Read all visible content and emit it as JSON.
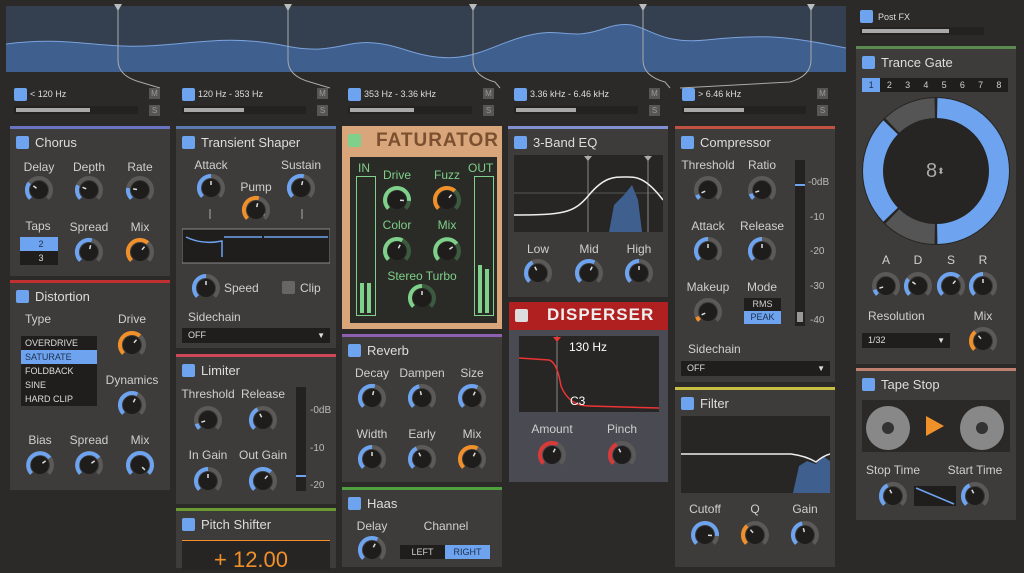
{
  "colors": {
    "accent": "#6ea4ef",
    "orange": "#f0902a",
    "green": "#7fd08a",
    "red": "#d83a3a",
    "track": "#5b5a58"
  },
  "bands": [
    {
      "label": "< 120 Hz",
      "level": 0.62
    },
    {
      "label": "120 Hz - 353 Hz",
      "level": 0.5
    },
    {
      "label": "353 Hz - 3.36 kHz",
      "level": 0.53
    },
    {
      "label": "3.36 kHz - 6.46 kHz",
      "level": 0.5
    },
    {
      "label": "> 6.46 kHz",
      "level": 0.5
    }
  ],
  "band_buttons": {
    "mute": "M",
    "solo": "S"
  },
  "post_fx": {
    "label": "Post FX",
    "level": 0.7
  },
  "chorus": {
    "title": "Chorus",
    "taps_label": "Taps",
    "taps": [
      "2",
      "3"
    ],
    "knobs": [
      {
        "label": "Delay",
        "value": 0.3,
        "color": "blue"
      },
      {
        "label": "Depth",
        "value": 0.25,
        "color": "blue"
      },
      {
        "label": "Rate",
        "value": 0.2,
        "color": "blue"
      },
      {
        "label": "Spread",
        "value": 0.55,
        "color": "blue"
      },
      {
        "label": "Mix",
        "value": 0.65,
        "color": "orange"
      }
    ]
  },
  "distortion": {
    "title": "Distortion",
    "type_label": "Type",
    "types": [
      "OVERDRIVE",
      "SATURATE",
      "FOLDBACK",
      "SINE",
      "HARD CLIP"
    ],
    "selected": "SATURATE",
    "knobs": [
      {
        "label": "Drive",
        "value": 0.65,
        "color": "orange"
      },
      {
        "label": "Dynamics",
        "value": 0.6,
        "color": "blue"
      },
      {
        "label": "Bias",
        "value": 0.7,
        "color": "blue"
      },
      {
        "label": "Spread",
        "value": 0.7,
        "color": "blue"
      },
      {
        "label": "Mix",
        "value": 1.0,
        "color": "blue"
      }
    ]
  },
  "transient_shaper": {
    "title": "Transient Shaper",
    "clip_label": "Clip",
    "sidechain_label": "Sidechain",
    "sidechain_value": "OFF",
    "knobs": [
      {
        "label": "Attack",
        "value": 0.5,
        "color": "blue"
      },
      {
        "label": "Pump",
        "value": 0.55,
        "color": "orange"
      },
      {
        "label": "Sustain",
        "value": 0.55,
        "color": "blue"
      },
      {
        "label": "Speed",
        "value": 0.5,
        "color": "blue"
      }
    ]
  },
  "limiter": {
    "title": "Limiter",
    "scale": [
      "-0dB",
      "-10",
      "-20"
    ],
    "knobs": [
      {
        "label": "Threshold",
        "value": 0.1,
        "color": "blue"
      },
      {
        "label": "Release",
        "value": 0.4,
        "color": "blue"
      },
      {
        "label": "In Gain",
        "value": 0.5,
        "color": "blue"
      },
      {
        "label": "Out Gain",
        "value": 0.65,
        "color": "blue"
      }
    ]
  },
  "pitch_shifter": {
    "title": "Pitch Shifter",
    "value": "+ 12.00"
  },
  "faturator": {
    "title": "FATURATOR",
    "in_label": "IN",
    "out_label": "OUT",
    "knobs": [
      {
        "label": "Drive",
        "value": 0.85,
        "color": "green"
      },
      {
        "label": "Fuzz",
        "value": 0.65,
        "color": "orange"
      },
      {
        "label": "Color",
        "value": 0.6,
        "color": "green"
      },
      {
        "label": "Mix",
        "value": 0.7,
        "color": "green"
      },
      {
        "label": "Stereo Turbo",
        "value": 0.5,
        "color": "green"
      }
    ]
  },
  "reverb": {
    "title": "Reverb",
    "knobs": [
      {
        "label": "Decay",
        "value": 0.55,
        "color": "blue"
      },
      {
        "label": "Dampen",
        "value": 0.45,
        "color": "blue"
      },
      {
        "label": "Size",
        "value": 0.6,
        "color": "blue"
      },
      {
        "label": "Width",
        "value": 0.5,
        "color": "blue"
      },
      {
        "label": "Early",
        "value": 0.4,
        "color": "blue"
      },
      {
        "label": "Mix",
        "value": 0.6,
        "color": "orange"
      }
    ]
  },
  "haas": {
    "title": "Haas",
    "channel_label": "Channel",
    "channels": [
      "LEFT",
      "RIGHT"
    ],
    "selected": "RIGHT",
    "knobs": [
      {
        "label": "Delay",
        "value": 0.6,
        "color": "blue"
      }
    ]
  },
  "eq": {
    "title": "3-Band EQ",
    "knobs": [
      {
        "label": "Low",
        "value": 0.4,
        "color": "blue"
      },
      {
        "label": "Mid",
        "value": 0.6,
        "color": "blue"
      },
      {
        "label": "High",
        "value": 0.5,
        "color": "blue"
      }
    ]
  },
  "disperser": {
    "title": "DISPERSER",
    "freq": "130 Hz",
    "note": "C3",
    "knobs": [
      {
        "label": "Amount",
        "value": 0.6,
        "color": "red"
      },
      {
        "label": "Pinch",
        "value": 0.4,
        "color": "red"
      }
    ]
  },
  "compressor": {
    "title": "Compressor",
    "mode_label": "Mode",
    "modes": [
      "RMS",
      "PEAK"
    ],
    "selected": "PEAK",
    "scale": [
      "-0dB",
      "-10",
      "-20",
      "-30",
      "-40"
    ],
    "sidechain_label": "Sidechain",
    "sidechain_value": "OFF",
    "knobs": [
      {
        "label": "Threshold",
        "value": 0.08,
        "color": "blue"
      },
      {
        "label": "Ratio",
        "value": 0.1,
        "color": "blue"
      },
      {
        "label": "Attack",
        "value": 0.5,
        "color": "blue"
      },
      {
        "label": "Release",
        "value": 0.5,
        "color": "blue"
      },
      {
        "label": "Makeup",
        "value": 0.08,
        "color": "orange"
      }
    ]
  },
  "filter": {
    "title": "Filter",
    "knobs": [
      {
        "label": "Cutoff",
        "value": 0.85,
        "color": "blue"
      },
      {
        "label": "Q",
        "value": 0.35,
        "color": "orange"
      },
      {
        "label": "Gain",
        "value": 0.45,
        "color": "blue"
      }
    ]
  },
  "trance_gate": {
    "title": "Trance Gate",
    "patterns": [
      "1",
      "2",
      "3",
      "4",
      "5",
      "6",
      "7",
      "8"
    ],
    "selected_pattern": "1",
    "steps": "8",
    "resolution_label": "Resolution",
    "resolution": "1/32",
    "knobs": [
      {
        "label": "A",
        "value": 0.1,
        "color": "blue"
      },
      {
        "label": "D",
        "value": 0.3,
        "color": "blue"
      },
      {
        "label": "S",
        "value": 0.65,
        "color": "blue"
      },
      {
        "label": "R",
        "value": 0.5,
        "color": "blue"
      },
      {
        "label": "Mix",
        "value": 0.35,
        "color": "orange"
      }
    ]
  },
  "tape_stop": {
    "title": "Tape Stop",
    "knobs": [
      {
        "label": "Stop Time",
        "value": 0.4,
        "color": "blue"
      },
      {
        "label": "Start Time",
        "value": 0.4,
        "color": "blue"
      }
    ]
  }
}
